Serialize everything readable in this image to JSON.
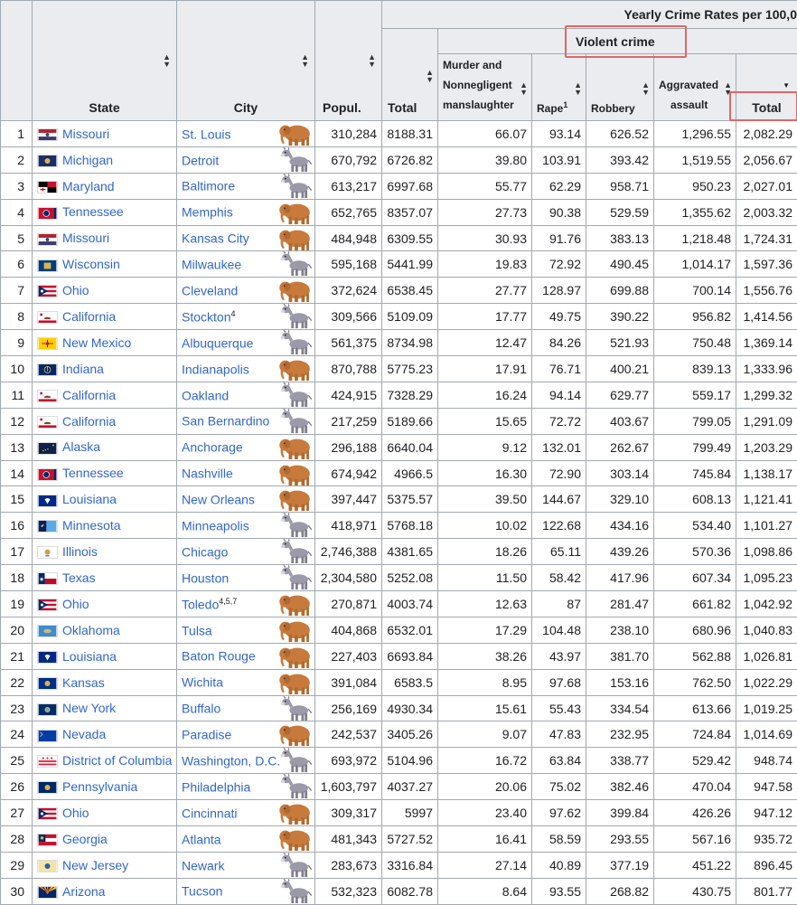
{
  "header": {
    "super_title": "Yearly Crime Rates per 100,0",
    "violent_crime": "Violent crime",
    "cols": {
      "state": "State",
      "city": "City",
      "popul": "Popul.",
      "total": "Total",
      "murder_l1": "Murder and",
      "murder_l2": "Nonnegligent",
      "murder_l3": "manslaughter",
      "rape": "Rape",
      "rape_sup": "1",
      "robbery": "Robbery",
      "agg_l1": "Aggravated",
      "agg_l2": "assault",
      "vc_total": "Total"
    }
  },
  "colors": {
    "link": "#3366cc",
    "header_bg": "#eaecf0",
    "border": "#a2a9b1",
    "highlight": "#e06666",
    "elephant": "#c87a3c",
    "donkey": "#9a9aa8"
  },
  "rows": [
    {
      "rank": "1",
      "state": "Missouri",
      "flag": "missouri",
      "city": "St. Louis",
      "city_sup": "",
      "animal": "elephant",
      "popul": "310,284",
      "total": "8188.31",
      "murder": "66.07",
      "rape": "93.14",
      "robbery": "626.52",
      "agg": "1,296.55",
      "vc_total": "2,082.29"
    },
    {
      "rank": "2",
      "state": "Michigan",
      "flag": "michigan",
      "city": "Detroit",
      "city_sup": "",
      "animal": "donkey",
      "popul": "670,792",
      "total": "6726.82",
      "murder": "39.80",
      "rape": "103.91",
      "robbery": "393.42",
      "agg": "1,519.55",
      "vc_total": "2,056.67"
    },
    {
      "rank": "3",
      "state": "Maryland",
      "flag": "maryland",
      "city": "Baltimore",
      "city_sup": "",
      "animal": "donkey",
      "popul": "613,217",
      "total": "6997.68",
      "murder": "55.77",
      "rape": "62.29",
      "robbery": "958.71",
      "agg": "950.23",
      "vc_total": "2,027.01"
    },
    {
      "rank": "4",
      "state": "Tennessee",
      "flag": "tennessee",
      "city": "Memphis",
      "city_sup": "",
      "animal": "elephant",
      "popul": "652,765",
      "total": "8357.07",
      "murder": "27.73",
      "rape": "90.38",
      "robbery": "529.59",
      "agg": "1,355.62",
      "vc_total": "2,003.32"
    },
    {
      "rank": "5",
      "state": "Missouri",
      "flag": "missouri",
      "city": "Kansas City",
      "city_sup": "",
      "animal": "elephant",
      "popul": "484,948",
      "total": "6309.55",
      "murder": "30.93",
      "rape": "91.76",
      "robbery": "383.13",
      "agg": "1,218.48",
      "vc_total": "1,724.31"
    },
    {
      "rank": "6",
      "state": "Wisconsin",
      "flag": "wisconsin",
      "city": "Milwaukee",
      "city_sup": "",
      "animal": "donkey",
      "popul": "595,168",
      "total": "5441.99",
      "murder": "19.83",
      "rape": "72.92",
      "robbery": "490.45",
      "agg": "1,014.17",
      "vc_total": "1,597.36"
    },
    {
      "rank": "7",
      "state": "Ohio",
      "flag": "ohio",
      "city": "Cleveland",
      "city_sup": "",
      "animal": "elephant",
      "popul": "372,624",
      "total": "6538.45",
      "murder": "27.77",
      "rape": "128.97",
      "robbery": "699.88",
      "agg": "700.14",
      "vc_total": "1,556.76"
    },
    {
      "rank": "8",
      "state": "California",
      "flag": "california",
      "city": "Stockton",
      "city_sup": "4",
      "animal": "donkey",
      "popul": "309,566",
      "total": "5109.09",
      "murder": "17.77",
      "rape": "49.75",
      "robbery": "390.22",
      "agg": "956.82",
      "vc_total": "1,414.56"
    },
    {
      "rank": "9",
      "state": "New Mexico",
      "flag": "newmexico",
      "city": "Albuquerque",
      "city_sup": "",
      "animal": "donkey",
      "popul": "561,375",
      "total": "8734.98",
      "murder": "12.47",
      "rape": "84.26",
      "robbery": "521.93",
      "agg": "750.48",
      "vc_total": "1,369.14"
    },
    {
      "rank": "10",
      "state": "Indiana",
      "flag": "indiana",
      "city": "Indianapolis",
      "city_sup": "",
      "animal": "elephant",
      "popul": "870,788",
      "total": "5775.23",
      "murder": "17.91",
      "rape": "76.71",
      "robbery": "400.21",
      "agg": "839.13",
      "vc_total": "1,333.96"
    },
    {
      "rank": "11",
      "state": "California",
      "flag": "california",
      "city": "Oakland",
      "city_sup": "",
      "animal": "donkey",
      "popul": "424,915",
      "total": "7328.29",
      "murder": "16.24",
      "rape": "94.14",
      "robbery": "629.77",
      "agg": "559.17",
      "vc_total": "1,299.32"
    },
    {
      "rank": "12",
      "state": "California",
      "flag": "california",
      "city": "San Bernardino",
      "city_sup": "",
      "animal": "donkey",
      "popul": "217,259",
      "total": "5189.66",
      "murder": "15.65",
      "rape": "72.72",
      "robbery": "403.67",
      "agg": "799.05",
      "vc_total": "1,291.09"
    },
    {
      "rank": "13",
      "state": "Alaska",
      "flag": "alaska",
      "city": "Anchorage",
      "city_sup": "",
      "animal": "elephant",
      "popul": "296,188",
      "total": "6640.04",
      "murder": "9.12",
      "rape": "132.01",
      "robbery": "262.67",
      "agg": "799.49",
      "vc_total": "1,203.29"
    },
    {
      "rank": "14",
      "state": "Tennessee",
      "flag": "tennessee",
      "city": "Nashville",
      "city_sup": "",
      "animal": "elephant",
      "popul": "674,942",
      "total": "4966.5",
      "murder": "16.30",
      "rape": "72.90",
      "robbery": "303.14",
      "agg": "745.84",
      "vc_total": "1,138.17"
    },
    {
      "rank": "15",
      "state": "Louisiana",
      "flag": "louisiana",
      "city": "New Orleans",
      "city_sup": "",
      "animal": "elephant",
      "popul": "397,447",
      "total": "5375.57",
      "murder": "39.50",
      "rape": "144.67",
      "robbery": "329.10",
      "agg": "608.13",
      "vc_total": "1,121.41"
    },
    {
      "rank": "16",
      "state": "Minnesota",
      "flag": "minnesota",
      "city": "Minneapolis",
      "city_sup": "",
      "animal": "donkey",
      "popul": "418,971",
      "total": "5768.18",
      "murder": "10.02",
      "rape": "122.68",
      "robbery": "434.16",
      "agg": "534.40",
      "vc_total": "1,101.27"
    },
    {
      "rank": "17",
      "state": "Illinois",
      "flag": "illinois",
      "city": "Chicago",
      "city_sup": "",
      "animal": "donkey",
      "popul": "2,746,388",
      "total": "4381.65",
      "murder": "18.26",
      "rape": "65.11",
      "robbery": "439.26",
      "agg": "570.36",
      "vc_total": "1,098.86"
    },
    {
      "rank": "18",
      "state": "Texas",
      "flag": "texas",
      "city": "Houston",
      "city_sup": "",
      "animal": "donkey",
      "popul": "2,304,580",
      "total": "5252.08",
      "murder": "11.50",
      "rape": "58.42",
      "robbery": "417.96",
      "agg": "607.34",
      "vc_total": "1,095.23"
    },
    {
      "rank": "19",
      "state": "Ohio",
      "flag": "ohio",
      "city": "Toledo",
      "city_sup": "4,5,7",
      "animal": "elephant",
      "popul": "270,871",
      "total": "4003.74",
      "murder": "12.63",
      "rape": "87",
      "robbery": "281.47",
      "agg": "661.82",
      "vc_total": "1,042.92"
    },
    {
      "rank": "20",
      "state": "Oklahoma",
      "flag": "oklahoma",
      "city": "Tulsa",
      "city_sup": "",
      "animal": "elephant",
      "popul": "404,868",
      "total": "6532.01",
      "murder": "17.29",
      "rape": "104.48",
      "robbery": "238.10",
      "agg": "680.96",
      "vc_total": "1,040.83"
    },
    {
      "rank": "21",
      "state": "Louisiana",
      "flag": "louisiana",
      "city": "Baton Rouge",
      "city_sup": "",
      "animal": "elephant",
      "popul": "227,403",
      "total": "6693.84",
      "murder": "38.26",
      "rape": "43.97",
      "robbery": "381.70",
      "agg": "562.88",
      "vc_total": "1,026.81"
    },
    {
      "rank": "22",
      "state": "Kansas",
      "flag": "kansas",
      "city": "Wichita",
      "city_sup": "",
      "animal": "elephant",
      "popul": "391,084",
      "total": "6583.5",
      "murder": "8.95",
      "rape": "97.68",
      "robbery": "153.16",
      "agg": "762.50",
      "vc_total": "1,022.29"
    },
    {
      "rank": "23",
      "state": "New York",
      "flag": "newyork",
      "city": "Buffalo",
      "city_sup": "",
      "animal": "donkey",
      "popul": "256,169",
      "total": "4930.34",
      "murder": "15.61",
      "rape": "55.43",
      "robbery": "334.54",
      "agg": "613.66",
      "vc_total": "1,019.25"
    },
    {
      "rank": "24",
      "state": "Nevada",
      "flag": "nevada",
      "city": "Paradise",
      "city_sup": "",
      "animal": "elephant",
      "popul": "242,537",
      "total": "3405.26",
      "murder": "9.07",
      "rape": "47.83",
      "robbery": "232.95",
      "agg": "724.84",
      "vc_total": "1,014.69"
    },
    {
      "rank": "25",
      "state": "District of Columbia",
      "flag": "dc",
      "city": "Washington, D.C.",
      "city_sup": "",
      "animal": "donkey",
      "popul": "693,972",
      "total": "5104.96",
      "murder": "16.72",
      "rape": "63.84",
      "robbery": "338.77",
      "agg": "529.42",
      "vc_total": "948.74"
    },
    {
      "rank": "26",
      "state": "Pennsylvania",
      "flag": "pennsylvania",
      "city": "Philadelphia",
      "city_sup": "",
      "animal": "donkey",
      "popul": "1,603,797",
      "total": "4037.27",
      "murder": "20.06",
      "rape": "75.02",
      "robbery": "382.46",
      "agg": "470.04",
      "vc_total": "947.58"
    },
    {
      "rank": "27",
      "state": "Ohio",
      "flag": "ohio",
      "city": "Cincinnati",
      "city_sup": "",
      "animal": "elephant",
      "popul": "309,317",
      "total": "5997",
      "murder": "23.40",
      "rape": "97.62",
      "robbery": "399.84",
      "agg": "426.26",
      "vc_total": "947.12"
    },
    {
      "rank": "28",
      "state": "Georgia",
      "flag": "georgia",
      "city": "Atlanta",
      "city_sup": "",
      "animal": "elephant",
      "popul": "481,343",
      "total": "5727.52",
      "murder": "16.41",
      "rape": "58.59",
      "robbery": "293.55",
      "agg": "567.16",
      "vc_total": "935.72"
    },
    {
      "rank": "29",
      "state": "New Jersey",
      "flag": "newjersey",
      "city": "Newark",
      "city_sup": "",
      "animal": "donkey",
      "popul": "283,673",
      "total": "3316.84",
      "murder": "27.14",
      "rape": "40.89",
      "robbery": "377.19",
      "agg": "451.22",
      "vc_total": "896.45"
    },
    {
      "rank": "30",
      "state": "Arizona",
      "flag": "arizona",
      "city": "Tucson",
      "city_sup": "",
      "animal": "donkey",
      "popul": "532,323",
      "total": "6082.78",
      "murder": "8.64",
      "rape": "93.55",
      "robbery": "268.82",
      "agg": "430.75",
      "vc_total": "801.77"
    }
  ]
}
